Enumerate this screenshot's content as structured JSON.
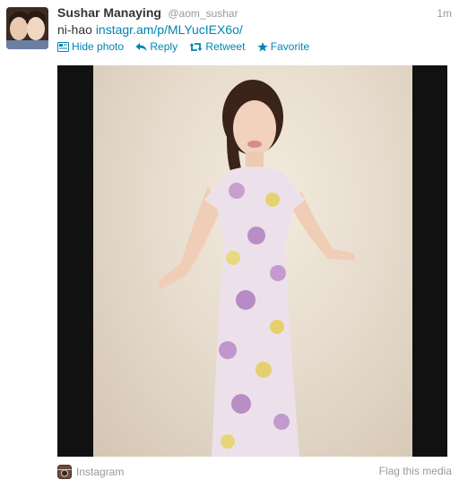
{
  "tweet": {
    "name": "Sushar Manaying",
    "handle": "@aom_sushar",
    "time": "1m",
    "text_prefix": "ni-hao ",
    "link": "instagr.am/p/MLYucIEX6o/",
    "actions": {
      "hide_photo": "Hide photo",
      "reply": "Reply",
      "retweet": "Retweet",
      "favorite": "Favorite"
    },
    "icons": {
      "hide_photo": "photo-icon",
      "reply": "reply-arrow-icon",
      "retweet": "retweet-icon",
      "favorite": "star-icon",
      "source": "instagram-icon"
    },
    "media": {
      "source": "Instagram",
      "flag": "Flag this media"
    }
  },
  "colors": {
    "link": "#0084b4",
    "muted": "#999999",
    "text": "#333333"
  }
}
